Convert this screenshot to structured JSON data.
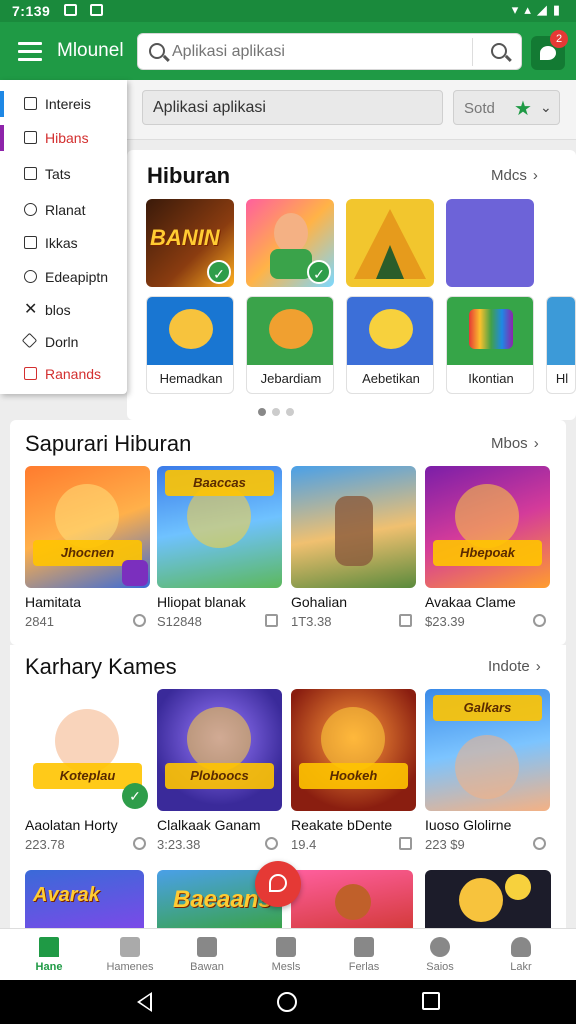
{
  "status": {
    "time": "7:139"
  },
  "header": {
    "title": "Mlounel",
    "search_placeholder": "Aplikasi aplikasi",
    "notification_count": "2"
  },
  "drawer": {
    "items": [
      {
        "label": "Intereis"
      },
      {
        "label": "Hibans"
      },
      {
        "label": "Tats"
      },
      {
        "label": "Rlanat"
      },
      {
        "label": "Ikkas"
      },
      {
        "label": "Edeapiptn"
      },
      {
        "label": "blos"
      },
      {
        "label": "Dorln"
      },
      {
        "label": "Ranands"
      }
    ]
  },
  "filter": {
    "input_value": "Aplikasi aplikasi",
    "sort_label": "Sotd"
  },
  "section1": {
    "title": "Hiburan",
    "more": "Mdcs",
    "row1": [
      {
        "art": "BANIN"
      },
      {},
      {},
      {}
    ],
    "apps": [
      {
        "label": "Hemadkan"
      },
      {
        "label": "Jebardiam"
      },
      {
        "label": "Aebetikan"
      },
      {
        "label": "Ikontian"
      },
      {
        "label": "Hl"
      }
    ]
  },
  "section2": {
    "title": "Sapurari Hiburan",
    "more": "Mbos",
    "games": [
      {
        "name": "Hamitata",
        "count": "2841",
        "art": "Jhocnen"
      },
      {
        "name": "Hliopat blanak",
        "count": "S12848",
        "art": "Baaccas"
      },
      {
        "name": "Gohalian",
        "count": "1T3.38",
        "art": ""
      },
      {
        "name": "Avakaa Clame",
        "count": "$23.39",
        "art": "Hbepoak"
      }
    ]
  },
  "section3": {
    "title": "Karhary Kames",
    "more": "Indote",
    "games": [
      {
        "name": "Aaolatan Horty",
        "count": "223.78",
        "art": "Koteplau"
      },
      {
        "name": "Clalkaak Ganam",
        "count": "3:23.38",
        "art": "Ploboocs"
      },
      {
        "name": "Reakate bDente",
        "count": "19.4",
        "art": "Hookeh"
      },
      {
        "name": "Iuoso Glolirne",
        "count": "223 $9",
        "art": "Galkars"
      }
    ]
  },
  "section4": {
    "arts": [
      "Avarak",
      "Baeaans",
      "",
      ""
    ]
  },
  "bottom_nav": [
    {
      "label": "Hane"
    },
    {
      "label": "Hamenes"
    },
    {
      "label": "Bawan"
    },
    {
      "label": "Mesls"
    },
    {
      "label": "Ferlas"
    },
    {
      "label": "Saios"
    },
    {
      "label": "Lakr"
    }
  ],
  "icons": {
    "menu": "hamburger-icon",
    "search": "search-icon",
    "chat": "chat-bubble-icon",
    "sort": "star-icon",
    "fab": "chat-icon"
  },
  "colors": {
    "primary": "#1f9a45",
    "accent": "#e53935",
    "status_bar": "#1a8a3c"
  }
}
